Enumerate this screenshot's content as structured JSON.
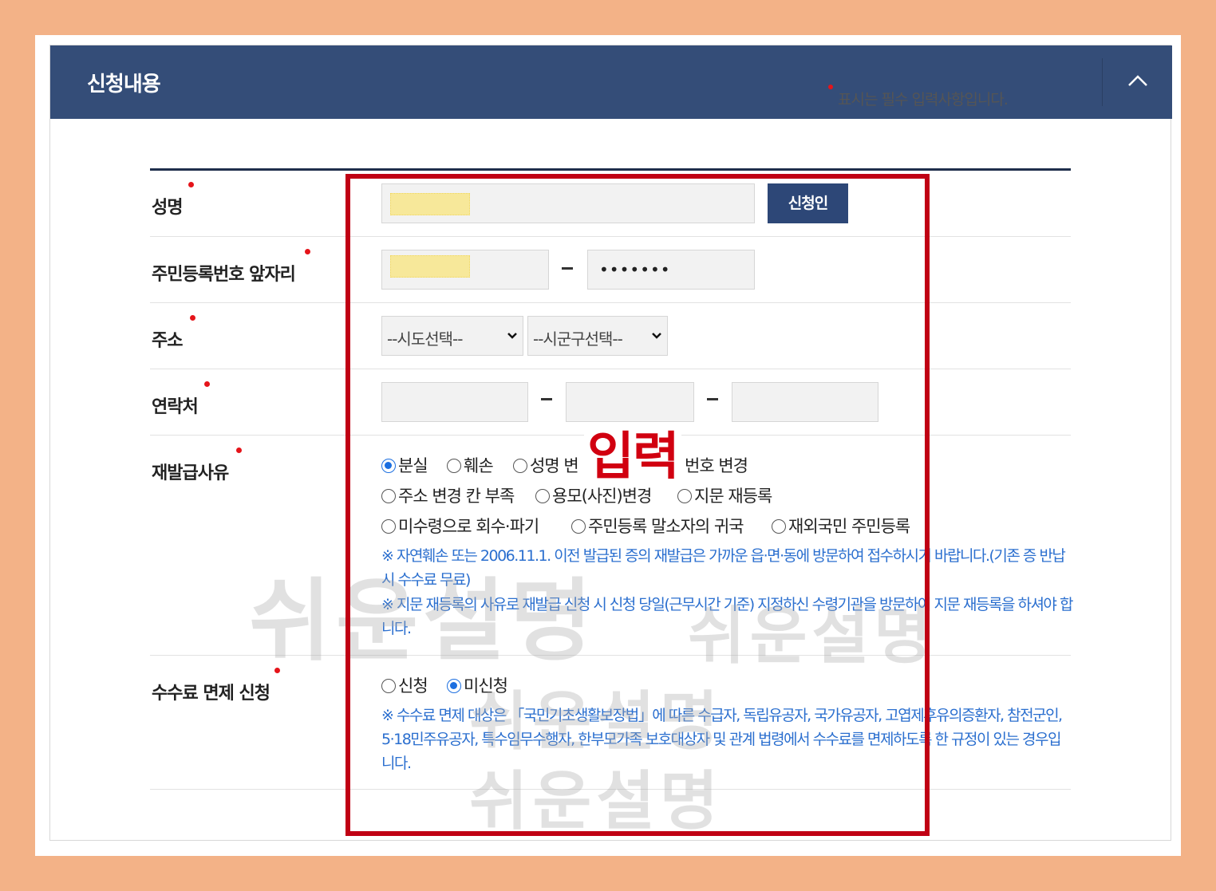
{
  "panel": {
    "title": "신청내용",
    "collapse_icon": "chevron-up-icon",
    "required_note": "표시는 필수 입력사항입니다."
  },
  "form": {
    "name": {
      "label": "성명",
      "button": "신청인"
    },
    "resident_id": {
      "label": "주민등록번호 앞자리",
      "separator": "-",
      "masked_value": "•••••••"
    },
    "address": {
      "label": "주소",
      "sido_selected": "--시도선택--",
      "sigungu_selected": "--시군구선택--"
    },
    "contact": {
      "label": "연락처",
      "separator": "-"
    },
    "reason": {
      "label": "재발급사유",
      "options": [
        {
          "label": "분실",
          "selected": true
        },
        {
          "label": "훼손",
          "selected": false
        },
        {
          "label": "성명 변",
          "selected": false
        },
        {
          "label": "번호 변경",
          "selected": false
        },
        {
          "label": "주소 변경 칸 부족",
          "selected": false
        },
        {
          "label": "용모(사진)변경",
          "selected": false
        },
        {
          "label": "지문 재등록",
          "selected": false
        },
        {
          "label": "미수령으로 회수·파기",
          "selected": false
        },
        {
          "label": "주민등록 말소자의 귀국",
          "selected": false
        },
        {
          "label": "재외국민 주민등록",
          "selected": false
        }
      ],
      "notice1": "※ 자연훼손 또는 2006.11.1. 이전 발급된 증의 재발급은 가까운 읍·면·동에 방문하여 접수하시기 바랍니다.(기존 증 반납시 수수료 무료)",
      "notice2": "※ 지문 재등록의 사유로 재발급 신청 시 신청 당일(근무시간 기준) 지정하신 수령기관을 방문하여 지문 재등록을 하셔야 합니다."
    },
    "fee_exemption": {
      "label": "수수료 면제 신청",
      "options": [
        {
          "label": "신청",
          "selected": false
        },
        {
          "label": "미신청",
          "selected": true
        }
      ],
      "notice": "※ 수수료 면제 대상은 「국민기초생활보장법」에 따른 수급자, 독립유공자, 국가유공자, 고엽제후유의증환자, 참전군인, 5·18민주유공자, 특수임무수행자, 한부모가족 보호대상자 및 관계 법령에서 수수료를 면제하도록 한 규정이 있는 경우입니다."
    }
  },
  "annotation": {
    "overlay_text": "입력",
    "box_color": "#c00014"
  },
  "watermark": {
    "text": "쉬운설명"
  },
  "colors": {
    "header_bg": "#344d78",
    "accent_blue": "#2b6fcf",
    "required_red": "#e5141a",
    "outer_bg": "#f3b287"
  }
}
